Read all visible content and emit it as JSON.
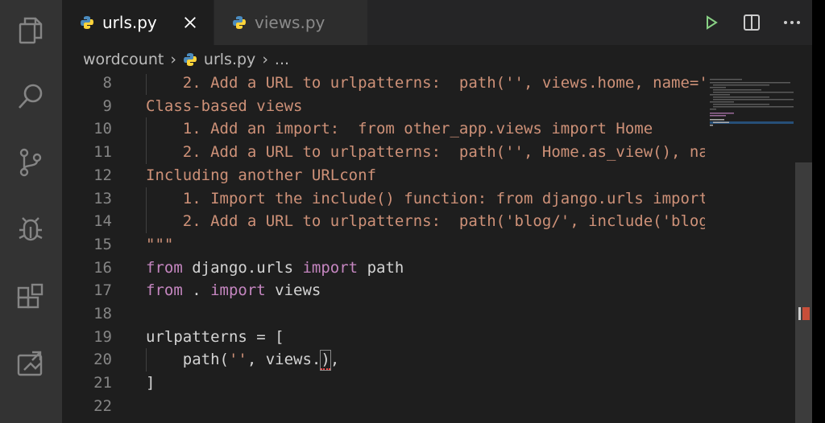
{
  "tabs": [
    {
      "label": "urls.py",
      "active": true
    },
    {
      "label": "views.py",
      "active": false
    }
  ],
  "breadcrumb": {
    "folder": "wordcount",
    "file": "urls.py",
    "more": "..."
  },
  "editor": {
    "lines": [
      {
        "n": "8",
        "text": "    2. Add a URL to urlpatterns:  path('', views.home, name='"
      },
      {
        "n": "9",
        "text": "Class-based views"
      },
      {
        "n": "10",
        "text": "    1. Add an import:  from other_app.views import Home"
      },
      {
        "n": "11",
        "text": "    2. Add a URL to urlpatterns:  path('', Home.as_view(), na"
      },
      {
        "n": "12",
        "text": "Including another URLconf"
      },
      {
        "n": "13",
        "text": "    1. Import the include() function: from django.urls import"
      },
      {
        "n": "14",
        "text": "    2. Add a URL to urlpatterns:  path('blog/', include('blog"
      },
      {
        "n": "15",
        "text": "\"\"\""
      },
      {
        "n": "16",
        "parts": [
          [
            "kw",
            "from"
          ],
          [
            "id",
            " django.urls "
          ],
          [
            "kw",
            "import"
          ],
          [
            "id",
            " path"
          ]
        ]
      },
      {
        "n": "17",
        "parts": [
          [
            "kw",
            "from"
          ],
          [
            "id",
            " . "
          ],
          [
            "kw",
            "import"
          ],
          [
            "id",
            " views"
          ]
        ]
      },
      {
        "n": "18",
        "text": ""
      },
      {
        "n": "19",
        "parts": [
          [
            "id",
            "urlpatterns "
          ],
          [
            "op",
            "="
          ],
          [
            "id",
            " ["
          ]
        ]
      },
      {
        "n": "20",
        "parts": [
          [
            "id",
            "    path("
          ],
          [
            "str",
            "''"
          ],
          [
            "id",
            ", views."
          ],
          [
            "cursor",
            ")"
          ],
          [
            "id",
            ","
          ]
        ]
      },
      {
        "n": "21",
        "parts": [
          [
            "id",
            "]"
          ]
        ]
      },
      {
        "n": "22",
        "text": ""
      }
    ]
  },
  "colors": {
    "keyword": "#c586c0",
    "string": "#ce9178",
    "identifier": "#d4d4d4",
    "line_number": "#858585",
    "run_icon": "#89d185"
  },
  "icons": {
    "activity": [
      "explorer-icon",
      "search-icon",
      "source-control-icon",
      "debug-icon",
      "extensions-icon",
      "remote-explorer-icon"
    ],
    "actions": [
      "run-icon",
      "split-editor-icon",
      "more-actions-icon"
    ]
  }
}
